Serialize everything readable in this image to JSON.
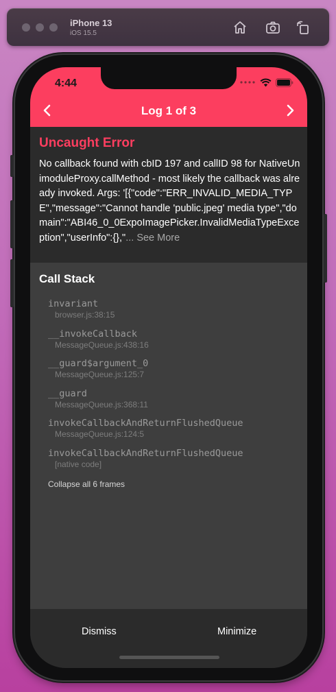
{
  "simulator": {
    "device_name": "iPhone 13",
    "os_version": "iOS 15.5",
    "toolbar_icons": [
      "home-icon",
      "screenshot-icon",
      "rotate-icon"
    ]
  },
  "status_bar": {
    "time": "4:44"
  },
  "nav": {
    "title": "Log 1 of 3",
    "back_icon": "chevron-left-icon",
    "forward_icon": "chevron-right-icon"
  },
  "error": {
    "title": "Uncaught Error",
    "message": "No callback found with cbID 197 and callID 98 for NativeUnimoduleProxy.callMethod - most likely the callback was already invoked. Args: '[{\"code\":\"ERR_INVALID_MEDIA_TYPE\",\"message\":\"Cannot handle 'public.jpeg' media type\",\"domain\":\"ABI46_0_0ExpoImagePicker.InvalidMediaTypeException\",\"userInfo\":{},\"",
    "see_more": "... See More"
  },
  "call_stack": {
    "title": "Call Stack",
    "frames": [
      {
        "name": "invariant",
        "location": "browser.js:38:15"
      },
      {
        "name": "__invokeCallback",
        "location": "MessageQueue.js:438:16"
      },
      {
        "name": "__guard$argument_0",
        "location": "MessageQueue.js:125:7"
      },
      {
        "name": "__guard",
        "location": "MessageQueue.js:368:11"
      },
      {
        "name": "invokeCallbackAndReturnFlushedQueue",
        "location": "MessageQueue.js:124:5"
      },
      {
        "name": "invokeCallbackAndReturnFlushedQueue",
        "location": "[native code]"
      }
    ],
    "collapse_label": "Collapse all 6 frames"
  },
  "actions": {
    "dismiss": "Dismiss",
    "minimize": "Minimize"
  },
  "colors": {
    "accent": "#fc3e5f",
    "error_bg": "#2b2b2b",
    "stack_bg": "#3e3e3e"
  }
}
